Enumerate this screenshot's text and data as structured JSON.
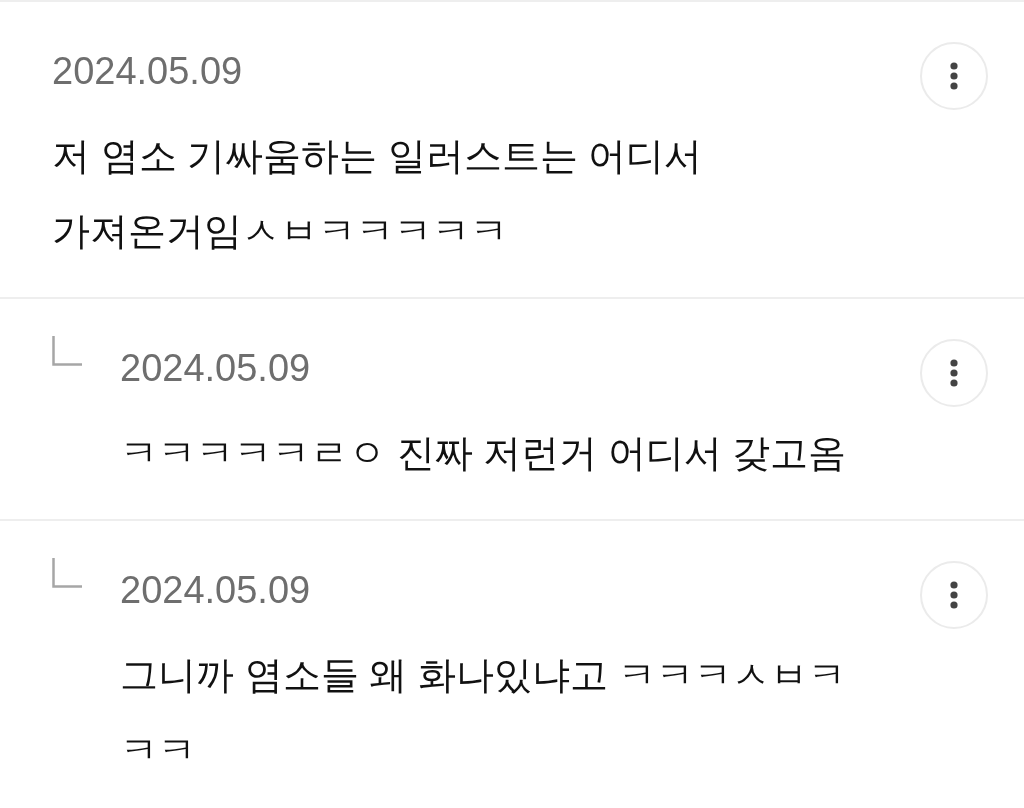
{
  "comments": [
    {
      "date": "2024.05.09",
      "text": "저 염소 기싸움하는 일러스트는 어디서 가져온거임ㅅㅂㅋㅋㅋㅋㅋ",
      "children": [
        {
          "date": "2024.05.09",
          "text": "ㅋㅋㅋㅋㅋㄹㅇ 진짜 저런거 어디서 갖고옴"
        },
        {
          "date": "2024.05.09",
          "text": "그니까 염소들 왜 화나있냐고 ㅋㅋㅋㅅㅂㅋㅋㅋ"
        }
      ]
    }
  ]
}
